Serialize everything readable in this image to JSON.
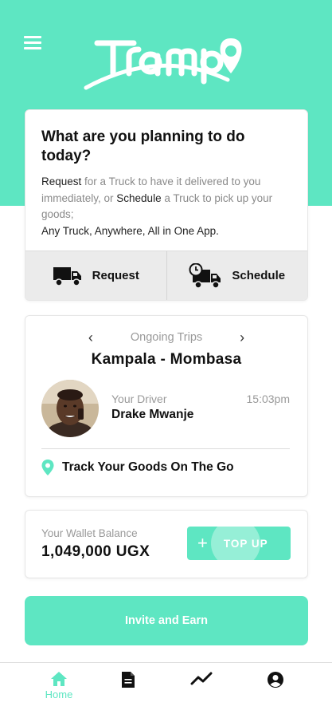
{
  "app": {
    "logo_text": "Trampo",
    "accent_color": "#5ee6c2"
  },
  "plan": {
    "title": "What are you planning to do today?",
    "desc_request_word": "Request",
    "desc_part1": " for a Truck to have it delivered to you immediately, or ",
    "desc_schedule_word": "Schedule",
    "desc_part2": " a Truck to pick up your goods;",
    "desc_tagline": "Any Truck, Anywhere, All in One App.",
    "request_label": "Request",
    "schedule_label": "Schedule"
  },
  "trips": {
    "label": "Ongoing Trips",
    "route": "Kampala - Mombasa",
    "driver_label": "Your Driver",
    "driver_name": "Drake Mwanje",
    "time": "15:03pm",
    "track_label": "Track Your Goods On The Go"
  },
  "wallet": {
    "label": "Your Wallet Balance",
    "amount": "1,049,000 UGX",
    "topup_label": "TOP UP"
  },
  "invite": {
    "label": "Invite and Earn"
  },
  "nav": {
    "items": [
      {
        "label": "Home",
        "icon": "home-icon",
        "active": true
      },
      {
        "label": "",
        "icon": "document-icon",
        "active": false
      },
      {
        "label": "",
        "icon": "activity-icon",
        "active": false
      },
      {
        "label": "",
        "icon": "profile-icon",
        "active": false
      }
    ]
  }
}
